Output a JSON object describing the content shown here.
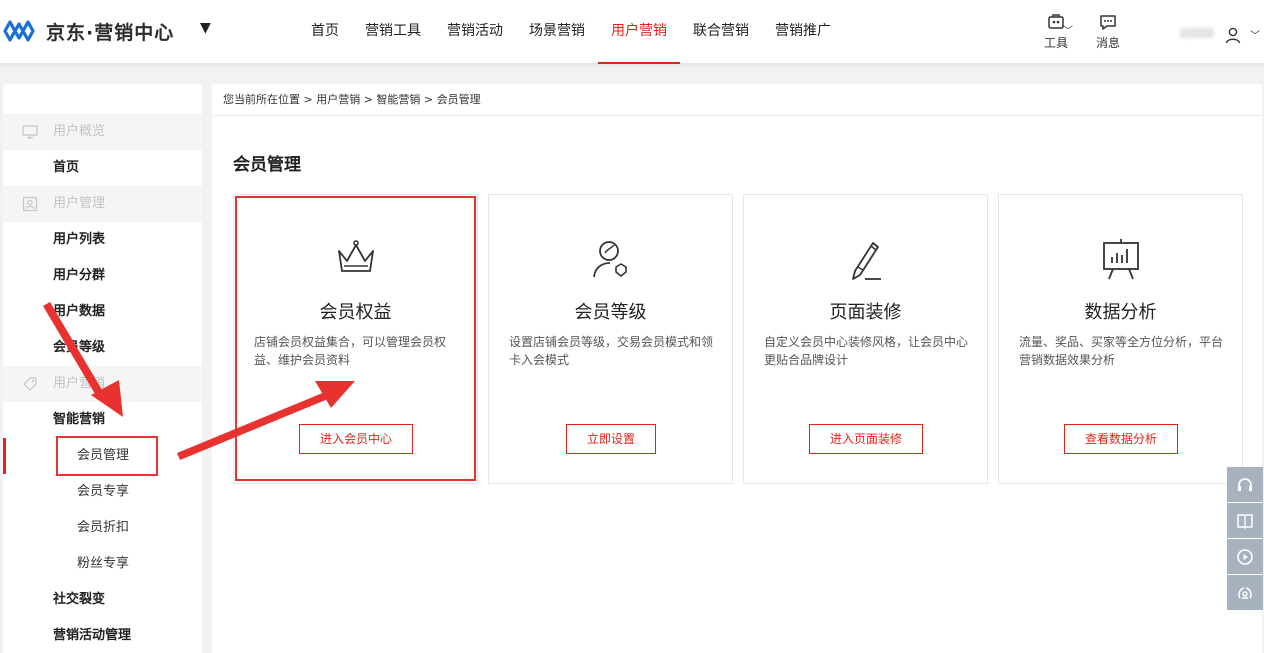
{
  "brand": {
    "name": "京东·营销中心"
  },
  "nav": {
    "items": [
      {
        "label": "首页",
        "active": false
      },
      {
        "label": "营销工具",
        "active": false
      },
      {
        "label": "营销活动",
        "active": false
      },
      {
        "label": "场景营销",
        "active": false
      },
      {
        "label": "用户营销",
        "active": true
      },
      {
        "label": "联合营销",
        "active": false
      },
      {
        "label": "营销推广",
        "active": false
      }
    ],
    "tool_label": "工具",
    "message_label": "消息"
  },
  "sidebar": {
    "groups": [
      {
        "label": "用户概览",
        "icon": "monitor-icon"
      },
      {
        "label": "用户管理",
        "icon": "user-card-icon"
      },
      {
        "label": "用户营销",
        "icon": "tag-icon"
      }
    ],
    "items": {
      "home": "首页",
      "user_list": "用户列表",
      "user_group": "用户分群",
      "user_data": "用户数据",
      "member_level": "会员等级",
      "smart_marketing": "智能营销",
      "member_manage": "会员管理",
      "member_exclusive": "会员专享",
      "member_discount": "会员折扣",
      "fans_exclusive": "粉丝专享",
      "social_fission": "社交裂变",
      "activity_manage": "营销活动管理"
    }
  },
  "main": {
    "breadcrumb": "您当前所在位置 > 用户营销 > 智能营销 > 会员管理",
    "title": "会员管理",
    "cards": [
      {
        "title": "会员权益",
        "icon": "crown-icon",
        "desc": "店铺会员权益集合，可以管理会员权益、维护会员资料",
        "button": "进入会员中心"
      },
      {
        "title": "会员等级",
        "icon": "user-badge-icon",
        "desc": "设置店铺会员等级，交易会员模式和领卡入会模式",
        "button": "立即设置"
      },
      {
        "title": "页面装修",
        "icon": "pencil-icon",
        "desc": "自定义会员中心装修风格，让会员中心更贴合品牌设计",
        "button": "进入页面装修"
      },
      {
        "title": "数据分析",
        "icon": "chart-board-icon",
        "desc": "流量、奖品、买家等全方位分析，平台营销数据效果分析",
        "button": "查看数据分析"
      }
    ]
  },
  "colors": {
    "accent": "#e2231a",
    "annotation": "#e8322f",
    "float_bg": "#a8b2be"
  },
  "float_tools": [
    "headset-icon",
    "book-icon",
    "play-icon",
    "feedback-icon"
  ]
}
